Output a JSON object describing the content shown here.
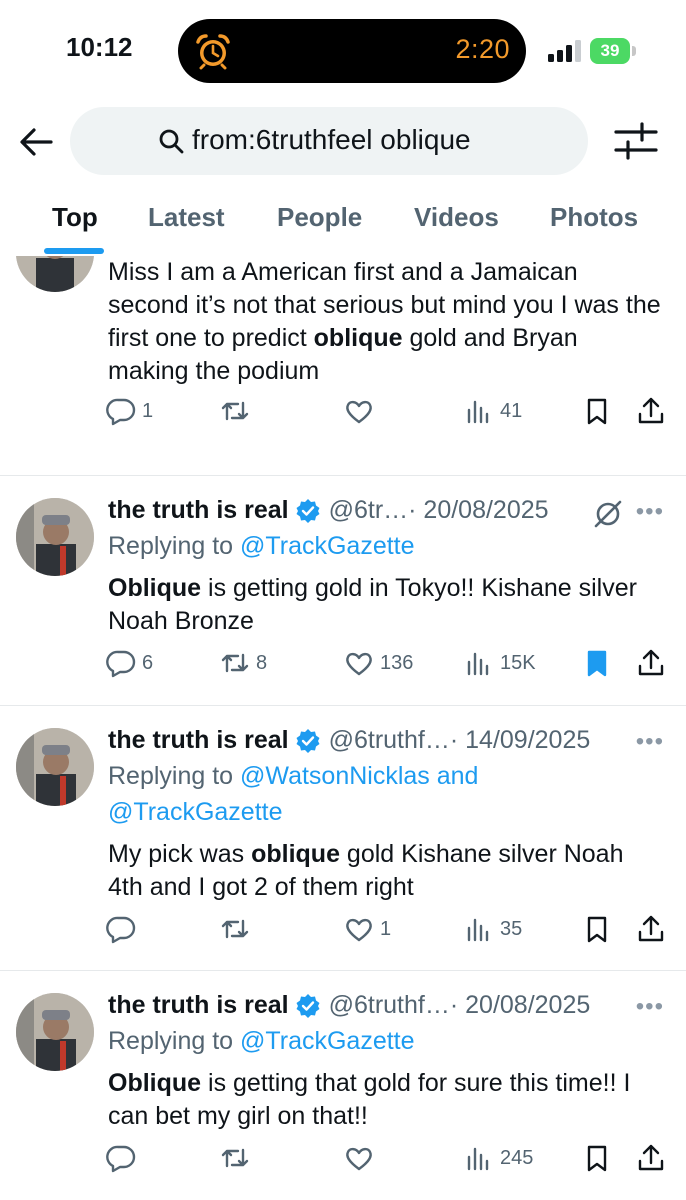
{
  "status_bar": {
    "time": "10:12",
    "timer_time": "2:20",
    "battery": "39"
  },
  "search": {
    "query": "from:6truthfeel oblique"
  },
  "tabs": [
    {
      "label": "Top",
      "active": true
    },
    {
      "label": "Latest",
      "active": false
    },
    {
      "label": "People",
      "active": false
    },
    {
      "label": "Videos",
      "active": false
    },
    {
      "label": "Photos",
      "active": false
    }
  ],
  "tweets": [
    {
      "partial": true,
      "text_before": "Miss I am a American first and a Jamaican second it’s not that serious but mind you I was the first one to predict ",
      "bold": "oblique",
      "text_after": " gold and Bryan making the podium",
      "replies": "1",
      "reposts": "",
      "likes": "",
      "views": "41",
      "bookmarked": false
    },
    {
      "name": "the truth is real",
      "handle": "@6tr…",
      "date": "· 20/08/2025",
      "replying_prefix": "Replying to ",
      "mentions": "@TrackGazette",
      "bold": "Oblique",
      "text_after": " is getting gold in Tokyo!! Kishane silver Noah Bronze",
      "replies": "6",
      "reposts": "8",
      "likes": "136",
      "views": "15K",
      "bookmarked": true
    },
    {
      "name": "the truth is real",
      "handle": "@6truthf…",
      "date": "· 14/09/2025",
      "replying_prefix": "Replying to ",
      "mentions": "@WatsonNicklas and",
      "mentions2": "@TrackGazette",
      "text_before": "My pick was ",
      "bold": "oblique",
      "text_after": " gold Kishane silver Noah 4th and I got 2 of them right",
      "replies": "",
      "reposts": "",
      "likes": "1",
      "views": "35",
      "bookmarked": false
    },
    {
      "name": "the truth is real",
      "handle": "@6truthf…",
      "date": "· 20/08/2025",
      "replying_prefix": "Replying to ",
      "mentions": "@TrackGazette",
      "bold": "Oblique",
      "text_after": " is getting that gold for sure this time!! I can bet my girl on that!!",
      "replies": "",
      "reposts": "",
      "likes": "",
      "views": "245",
      "bookmarked": false
    }
  ],
  "icons": {
    "back": "arrow-left-icon",
    "search": "search-icon",
    "filter": "sliders-icon",
    "reply": "comment-icon",
    "repost": "repost-icon",
    "like": "heart-icon",
    "views": "bar-chart-icon",
    "bookmark": "bookmark-icon",
    "share": "share-icon"
  },
  "colors": {
    "accent": "#1d9bf0",
    "text": "#0f1419",
    "muted": "#536471",
    "timer": "#f39a2b",
    "battery": "#4cd964"
  }
}
